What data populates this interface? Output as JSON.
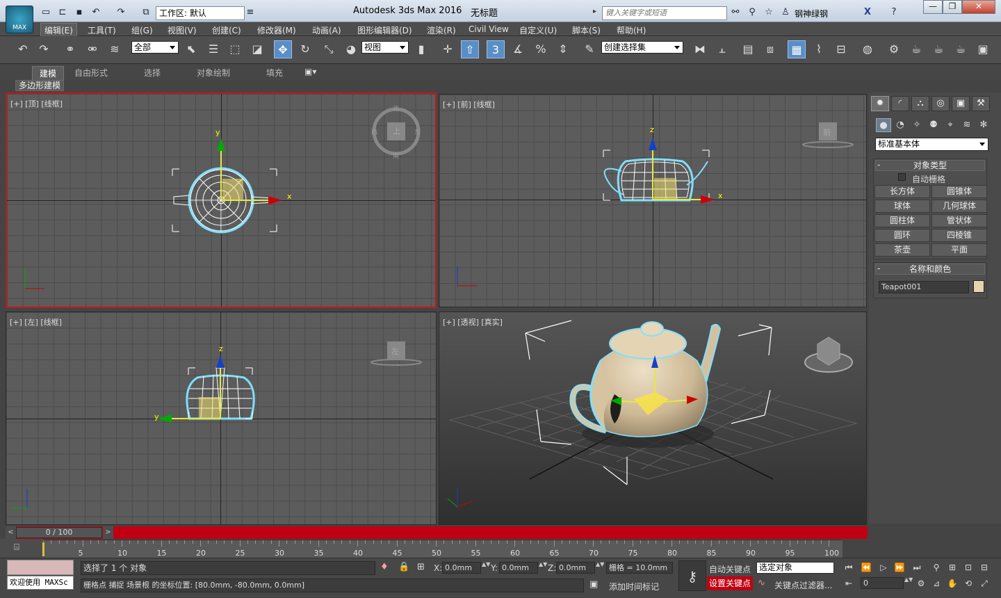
{
  "app": {
    "title": "Autodesk 3ds Max 2016",
    "doc_title": "无标题",
    "logo_text": "MAX",
    "workspace": "工作区: 默认",
    "search_placeholder": "键入关键字或短语",
    "user": "钢神绿钢"
  },
  "menu": [
    "编辑(E)",
    "工具(T)",
    "组(G)",
    "视图(V)",
    "创建(C)",
    "修改器(M)",
    "动画(A)",
    "图形编辑器(D)",
    "渲染(R)",
    "Civil View",
    "自定义(U)",
    "脚本(S)",
    "帮助(H)"
  ],
  "toolbar": {
    "filter": "全部",
    "ref_coord": "视图",
    "selection_set": "创建选择集",
    "snap_value": "3"
  },
  "ribbon": {
    "tabs": [
      "建模",
      "自由形式",
      "选择",
      "对象绘制",
      "填充"
    ],
    "sub": "多边形建模"
  },
  "viewports": [
    {
      "label": "[+] [顶] [线框]",
      "cube": "上",
      "dirs": [
        "北",
        "东",
        "南",
        "西"
      ]
    },
    {
      "label": "[+] [前] [线框]",
      "cube": "前"
    },
    {
      "label": "[+] [左] [线框]",
      "cube": "左"
    },
    {
      "label": "[+] [透视] [真实]",
      "cube": ""
    }
  ],
  "axes": {
    "x": "x",
    "y": "y",
    "z": "z"
  },
  "command_panel": {
    "category": "标准基本体",
    "object_type_title": "对象类型",
    "autogrid": "自动栅格",
    "objects": [
      "长方体",
      "圆锥体",
      "球体",
      "几何球体",
      "圆柱体",
      "管状体",
      "圆环",
      "四棱锥",
      "茶壶",
      "平面"
    ],
    "name_color_title": "名称和颜色",
    "object_name": "Teapot001",
    "object_color": "#e8d3b0"
  },
  "timeline": {
    "frame": "0 / 100",
    "ticks": [
      5,
      10,
      15,
      20,
      25,
      30,
      35,
      40,
      45,
      50,
      55,
      60,
      65,
      70,
      75,
      80,
      85,
      90,
      95,
      100
    ]
  },
  "status": {
    "welcome": "欢迎使用 MAXSc",
    "selection": "选择了 1 个 对象",
    "prompt": "栅格点 捕捉 场景根 的坐标位置: [80.0mm, -80.0mm, 0.0mm]",
    "x_label": "X:",
    "x": "0.0mm",
    "y_label": "Y:",
    "y": "0.0mm",
    "z_label": "Z:",
    "z": "0.0mm",
    "grid": "栅格 = 10.0mm",
    "add_time_tag": "添加时间标记",
    "auto_key": "自动关键点",
    "set_key": "设置关键点",
    "key_mode": "选定对象",
    "key_filters": "关键点过滤器...",
    "current_frame": "0"
  }
}
